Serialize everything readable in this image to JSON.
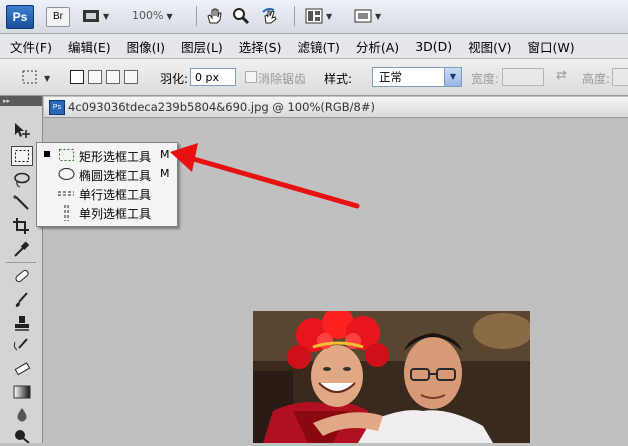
{
  "appbar": {
    "logo": "Ps",
    "bridge": "Br",
    "zoom": "100%",
    "icons": [
      "film-strip-icon",
      "hand-tool-icon",
      "zoom-tool-icon",
      "rotate-view-icon",
      "arrange-documents-icon",
      "screen-mode-icon"
    ]
  },
  "menu": [
    "文件(F)",
    "编辑(E)",
    "图像(I)",
    "图层(L)",
    "选择(S)",
    "滤镜(T)",
    "分析(A)",
    "3D(D)",
    "视图(V)",
    "窗口(W)"
  ],
  "options": {
    "feather_label": "羽化:",
    "feather_value": "0 px",
    "antialias_label": "消除锯齿",
    "style_label": "样式:",
    "style_value": "正常",
    "width_label": "宽度:",
    "height_label": "高度:"
  },
  "document": {
    "title": "4c093036tdeca239b5804&690.jpg @ 100%(RGB/8#)"
  },
  "flyout": {
    "items": [
      {
        "label": "矩形选框工具",
        "shortcut": "M",
        "selected": true,
        "icon": "rectangular-marquee-icon"
      },
      {
        "label": "椭圆选框工具",
        "shortcut": "M",
        "selected": false,
        "icon": "elliptical-marquee-icon"
      },
      {
        "label": "单行选框工具",
        "shortcut": "",
        "selected": false,
        "icon": "single-row-marquee-icon"
      },
      {
        "label": "单列选框工具",
        "shortcut": "",
        "selected": false,
        "icon": "single-column-marquee-icon"
      }
    ]
  },
  "colors": {
    "annotation_arrow": "#e81010",
    "canvas_bg": "#c0c0c0",
    "accent": "#2a66b8"
  }
}
